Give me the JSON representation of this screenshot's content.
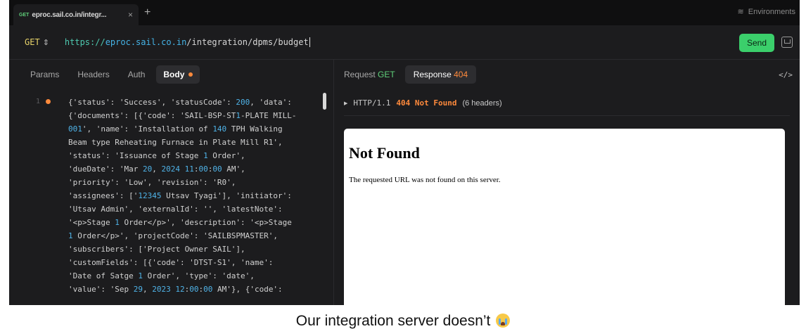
{
  "tab": {
    "method": "GET",
    "title": "eproc.sail.co.in/integr...",
    "close": "×"
  },
  "new_tab": "+",
  "environments": "Environments",
  "request": {
    "method": "GET",
    "url_scheme": "https://",
    "url_host": "eproc.sail.co.in",
    "url_path": "/integration/dpms/budget",
    "send_label": "Send"
  },
  "left_tabs": {
    "params": "Params",
    "headers": "Headers",
    "auth": "Auth",
    "body": "Body",
    "code_toggle": "</>"
  },
  "editor": {
    "line_number": "1"
  },
  "right_tabs": {
    "request_label": "Request",
    "request_method": "GET",
    "response_label": "Response",
    "response_code": "404"
  },
  "response": {
    "protocol": "HTTP/1.1",
    "status": "404 Not Found",
    "headers_count": "(6 headers)"
  },
  "preview": {
    "heading": "Not Found",
    "message": "The requested URL was not found on this server."
  },
  "caption": "Our integration server doesn’t"
}
